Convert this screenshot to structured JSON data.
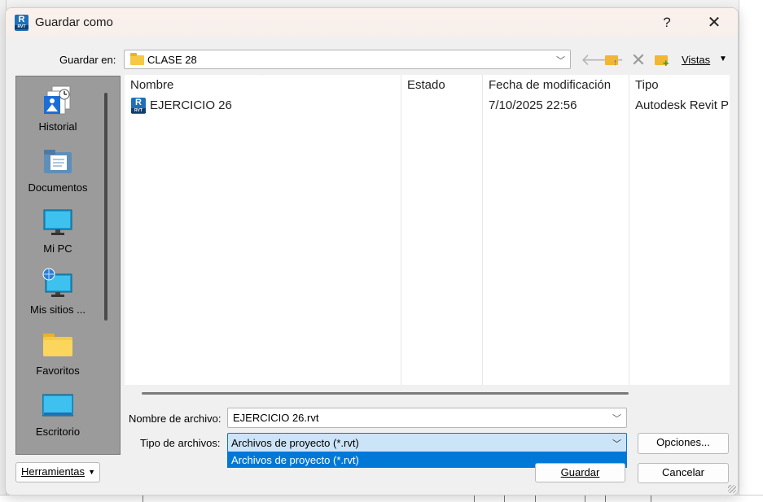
{
  "dialog": {
    "title": "Guardar como",
    "help": "?",
    "close": "✕"
  },
  "save_in": {
    "label": "Guardar en:",
    "value": "CLASE 28"
  },
  "toolbar": {
    "views_label": "Vistas"
  },
  "places": [
    {
      "label": "Historial",
      "icon": "history-icon"
    },
    {
      "label": "Documentos",
      "icon": "documents-icon"
    },
    {
      "label": "Mi PC",
      "icon": "computer-icon"
    },
    {
      "label": "Mis sitios ...",
      "icon": "network-places-icon"
    },
    {
      "label": "Favoritos",
      "icon": "favorites-folder-icon"
    },
    {
      "label": "Escritorio",
      "icon": "desktop-icon"
    }
  ],
  "file_list": {
    "columns": [
      "Nombre",
      "Estado",
      "Fecha de modificación",
      "Tipo"
    ],
    "rows": [
      {
        "name": "EJERCICIO 26",
        "status": "",
        "modified": "7/10/2025 22:56",
        "type": "Autodesk Revit Pr"
      }
    ]
  },
  "file_name": {
    "label": "Nombre de archivo:",
    "value": "EJERCICIO 26.rvt"
  },
  "file_type": {
    "label": "Tipo de archivos:",
    "value": "Archivos de proyecto (*.rvt)",
    "options": [
      "Archivos de proyecto (*.rvt)"
    ]
  },
  "buttons": {
    "options": "Opciones...",
    "save": "Guardar",
    "cancel": "Cancelar",
    "tools": "Herramientas"
  },
  "colors": {
    "accent": "#0078d7",
    "selection_bg": "#cce4f7",
    "places_bg": "#9b9b9b",
    "revit_blue": "#1f6fb7"
  }
}
